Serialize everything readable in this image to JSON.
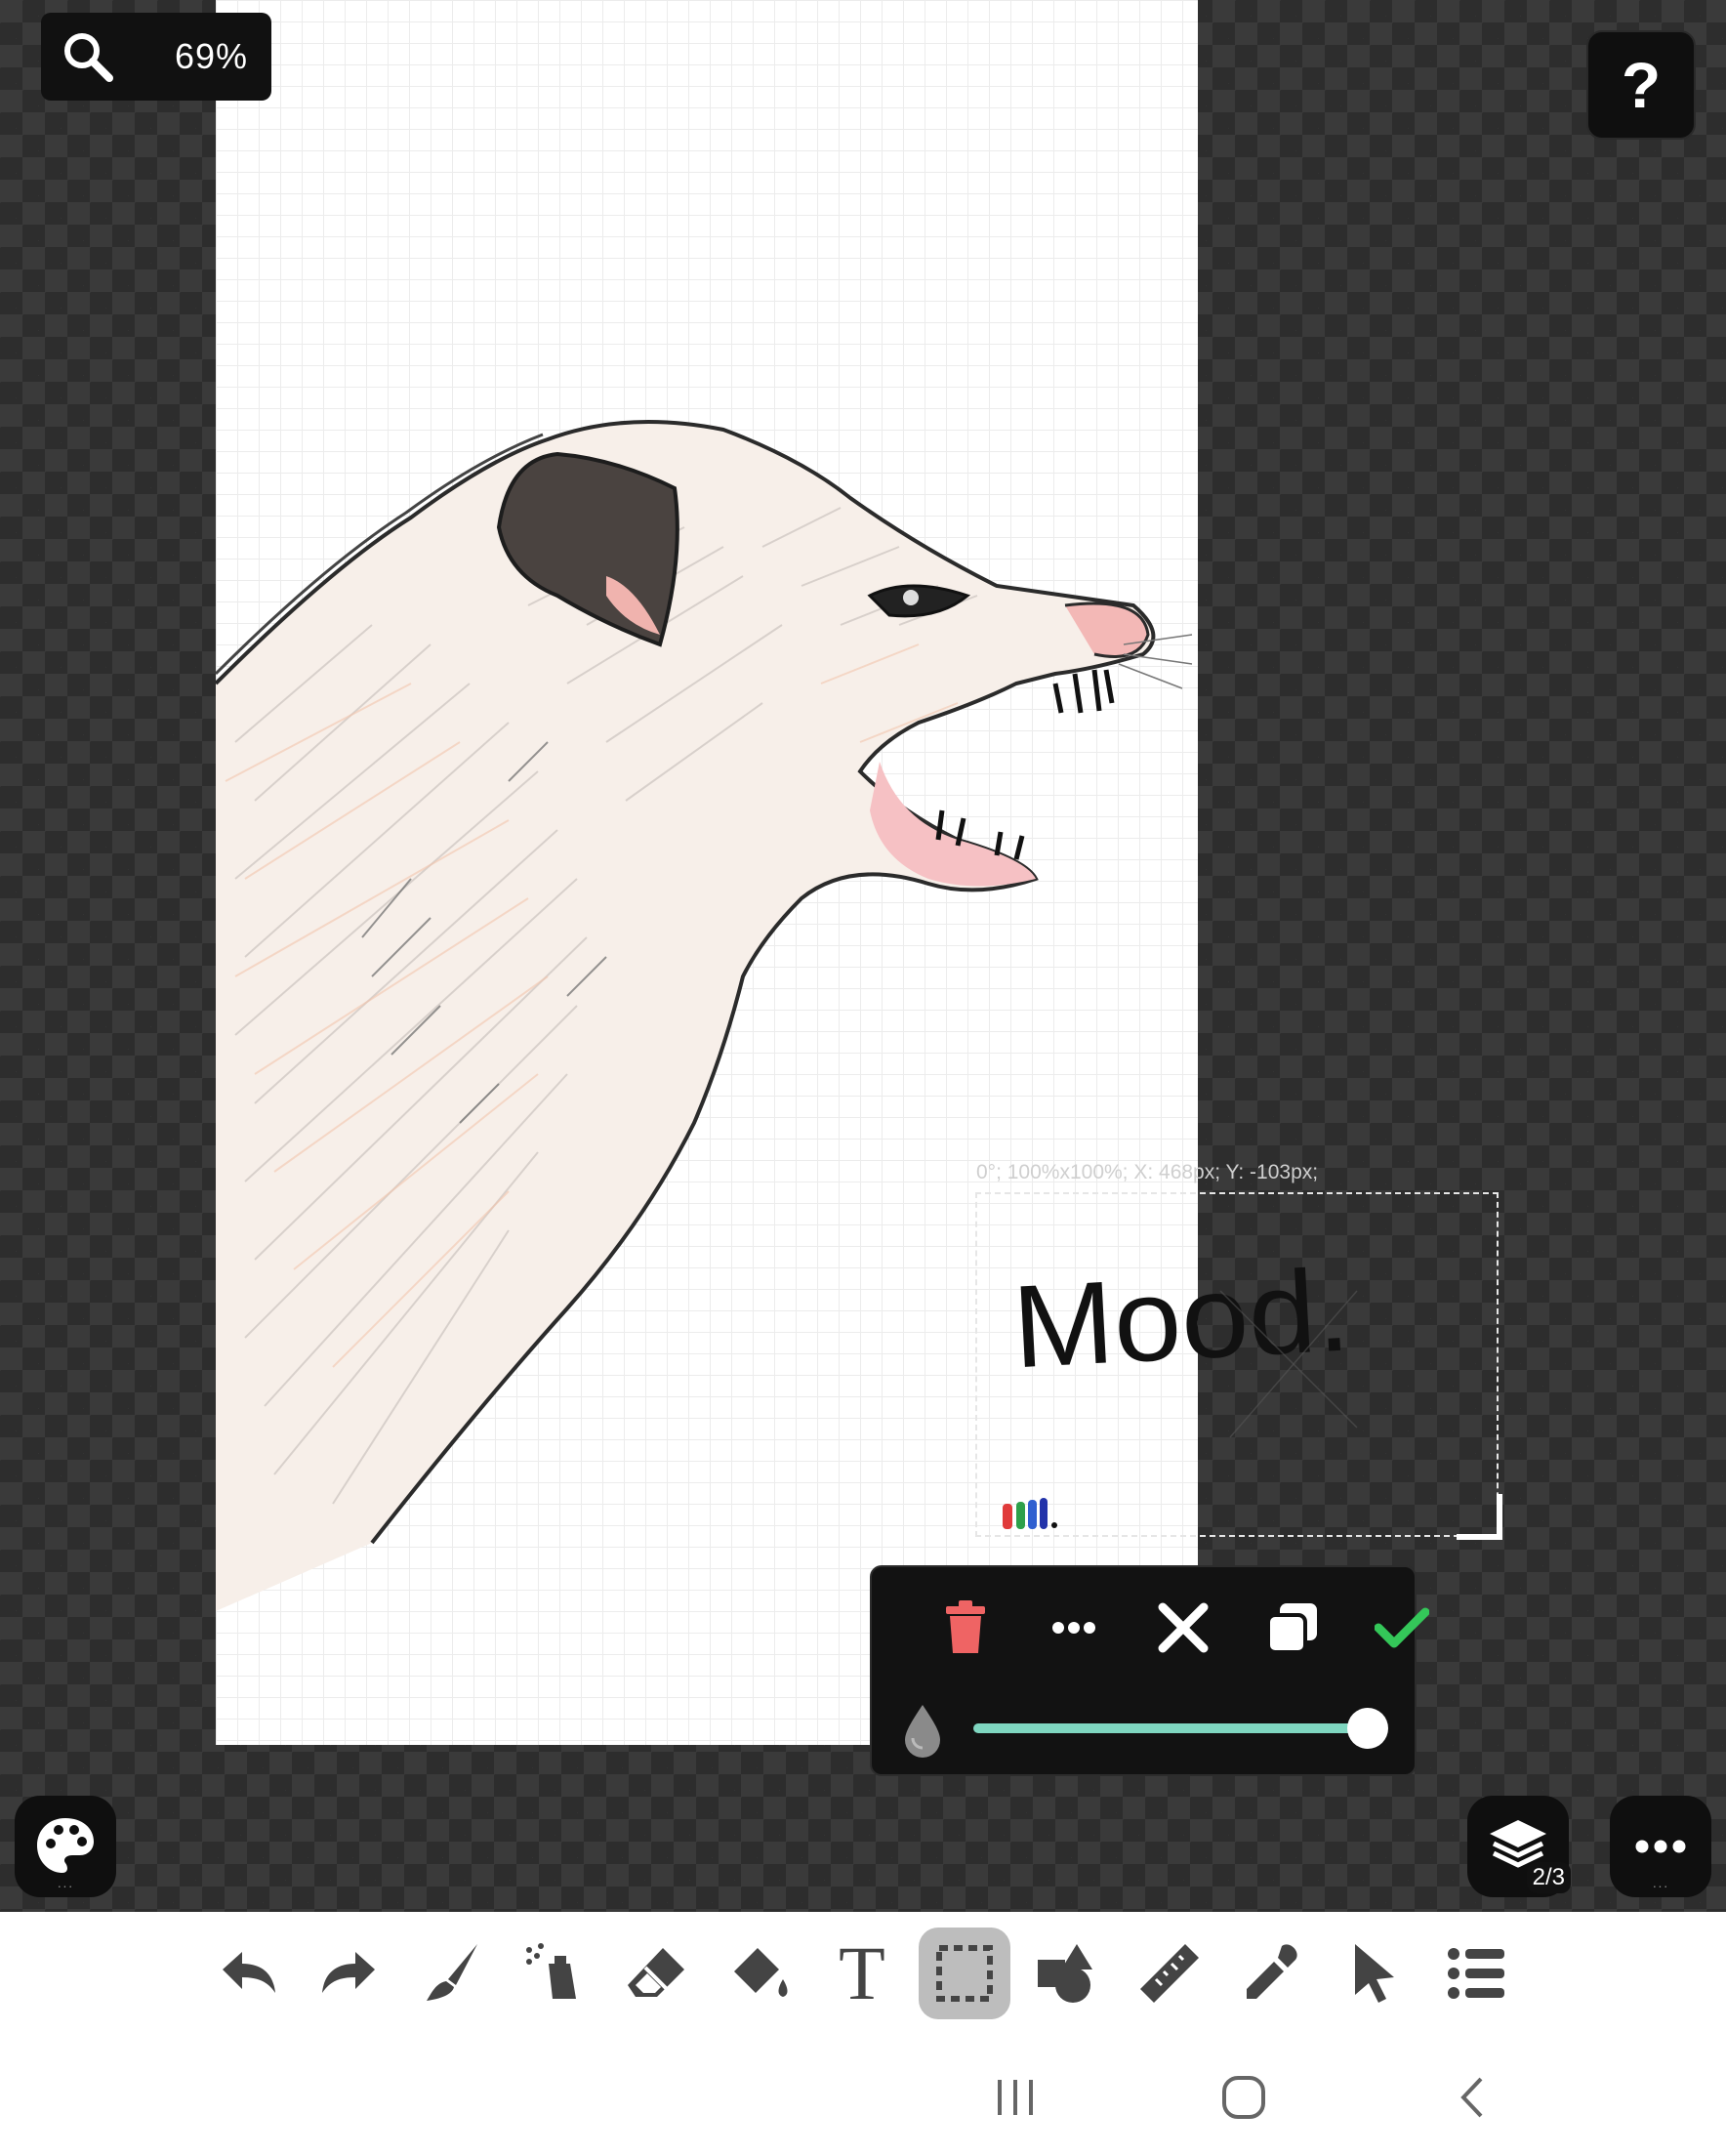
{
  "zoom": {
    "value": "69%"
  },
  "help": {
    "label": "?"
  },
  "selection": {
    "info": "0°; 100%x100%; X: 468px; Y: -103px;",
    "content_text": "Mood."
  },
  "action_panel": {
    "buttons": [
      "delete",
      "more",
      "cancel",
      "duplicate",
      "apply"
    ],
    "opacity_level": 1.0
  },
  "layers": {
    "count": "2/3"
  },
  "toolbar": {
    "tools": [
      "undo",
      "redo",
      "brush",
      "spray",
      "eraser",
      "fill",
      "text",
      "select",
      "shapes",
      "ruler",
      "eyedropper",
      "pointer",
      "menu"
    ],
    "text_tool_glyph": "T",
    "active_tool": "select"
  },
  "colors": {
    "accent": "#7fd6c0",
    "delete": "#ef6464",
    "confirm": "#34c759",
    "workspace_dark": "#3a3a3a"
  }
}
